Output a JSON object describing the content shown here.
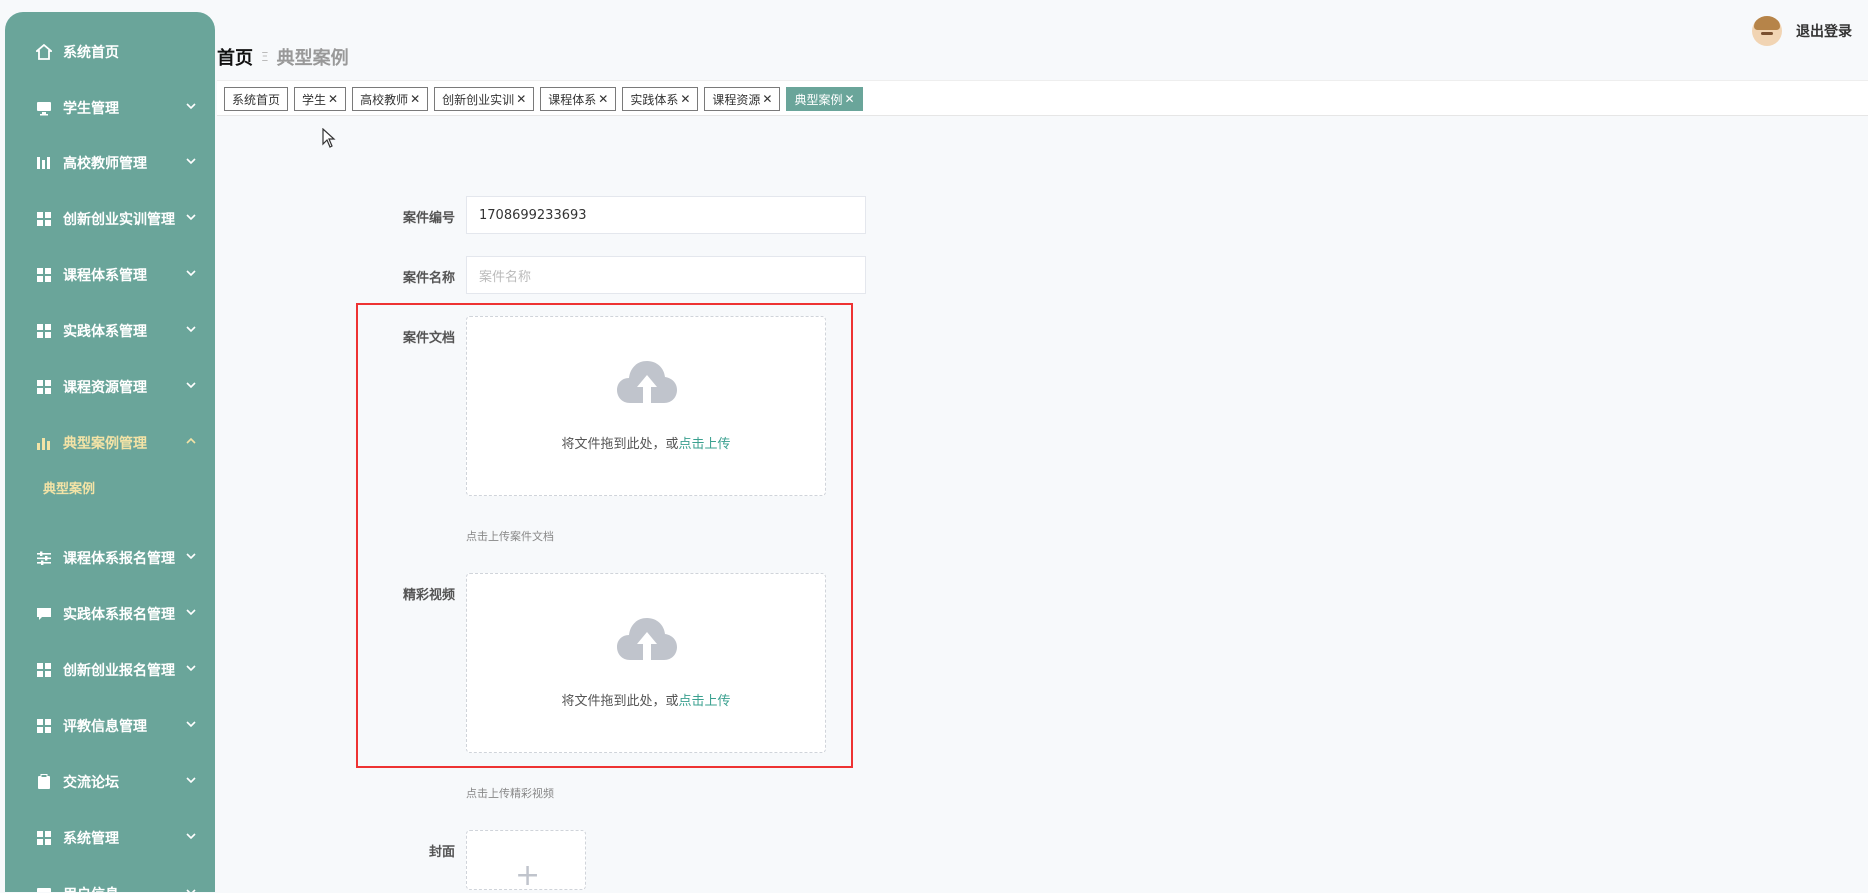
{
  "sidebar": {
    "items": [
      {
        "label": "系统首页",
        "icon": "home-icon",
        "chevron": false
      },
      {
        "label": "学生管理",
        "icon": "monitor-icon",
        "chevron": "down"
      },
      {
        "label": "高校教师管理",
        "icon": "bars-icon",
        "chevron": "down"
      },
      {
        "label": "创新创业实训管理",
        "icon": "grid-icon",
        "chevron": "down"
      },
      {
        "label": "课程体系管理",
        "icon": "grid-icon",
        "chevron": "down"
      },
      {
        "label": "实践体系管理",
        "icon": "grid-icon",
        "chevron": "down"
      },
      {
        "label": "课程资源管理",
        "icon": "grid-icon",
        "chevron": "down"
      },
      {
        "label": "典型案例管理",
        "icon": "chart-icon",
        "chevron": "up",
        "active": true
      },
      {
        "label": "课程体系报名管理",
        "icon": "sliders-icon",
        "chevron": "down"
      },
      {
        "label": "实践体系报名管理",
        "icon": "chat-icon",
        "chevron": "down"
      },
      {
        "label": "创新创业报名管理",
        "icon": "grid-icon",
        "chevron": "down"
      },
      {
        "label": "评教信息管理",
        "icon": "grid-icon",
        "chevron": "down"
      },
      {
        "label": "交流论坛",
        "icon": "clipboard-icon",
        "chevron": "down"
      },
      {
        "label": "系统管理",
        "icon": "grid-icon",
        "chevron": "down"
      },
      {
        "label": "用户信息",
        "icon": "monitor-icon",
        "chevron": "down"
      }
    ],
    "submenu_label": "典型案例"
  },
  "breadcrumb": {
    "home": "首页",
    "separator": "Ξ",
    "current": "典型案例"
  },
  "header": {
    "logout_label": "退出登录"
  },
  "tabs": [
    {
      "label": "系统首页",
      "closable": false
    },
    {
      "label": "学生",
      "closable": true
    },
    {
      "label": "高校教师",
      "closable": true
    },
    {
      "label": "创新创业实训",
      "closable": true
    },
    {
      "label": "课程体系",
      "closable": true
    },
    {
      "label": "实践体系",
      "closable": true
    },
    {
      "label": "课程资源",
      "closable": true
    },
    {
      "label": "典型案例",
      "closable": true,
      "active": true
    }
  ],
  "close_glyph": "✕",
  "form": {
    "case_number_label": "案件编号",
    "case_number_value": "1708699233693",
    "case_name_label": "案件名称",
    "case_name_placeholder": "案件名称",
    "case_doc_label": "案件文档",
    "upload_text": "将文件拖到此处，或",
    "upload_link": "点击上传",
    "case_doc_tip": "点击上传案件文档",
    "video_label": "精彩视频",
    "video_tip": "点击上传精彩视频",
    "cover_label": "封面",
    "cover_plus": "+"
  },
  "colors": {
    "sidebar_bg": "#6aa59a",
    "active_menu": "#f3e3a6",
    "link": "#3aa08f",
    "highlight_box": "#ee3333"
  }
}
